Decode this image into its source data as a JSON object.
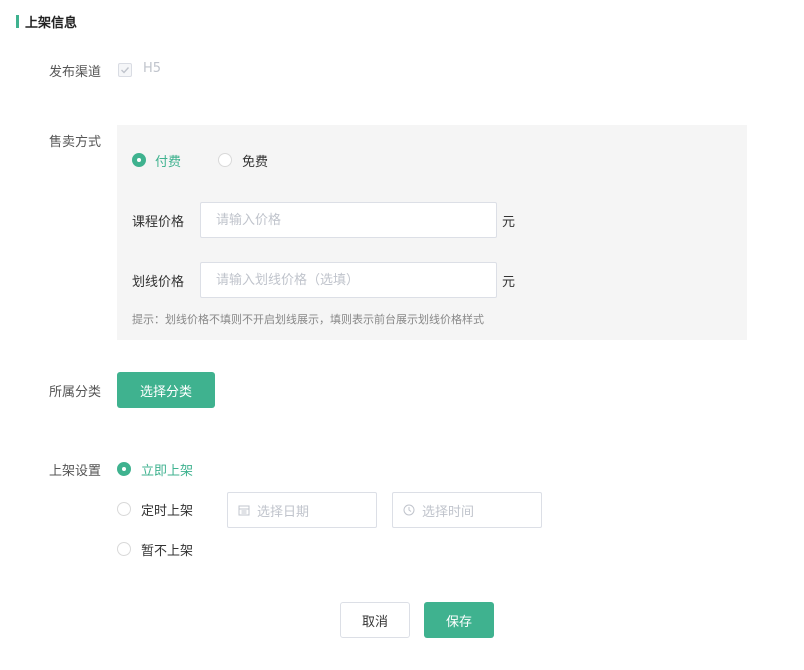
{
  "section": {
    "title": "上架信息"
  },
  "publish_channel": {
    "label": "发布渠道",
    "option": "H5",
    "checked": true,
    "disabled": true
  },
  "sale_method": {
    "label": "售卖方式",
    "options": [
      {
        "label": "付费",
        "selected": true
      },
      {
        "label": "免费",
        "selected": false
      }
    ],
    "course_price": {
      "label": "课程价格",
      "placeholder": "请输入价格",
      "unit": "元"
    },
    "strike_price": {
      "label": "划线价格",
      "placeholder": "请输入划线价格（选填）",
      "unit": "元"
    },
    "hint": "提示：划线价格不填则不开启划线展示，填则表示前台展示划线价格样式"
  },
  "category": {
    "label": "所属分类",
    "button": "选择分类"
  },
  "listing": {
    "label": "上架设置",
    "options": [
      {
        "label": "立即上架",
        "selected": true
      },
      {
        "label": "定时上架",
        "selected": false
      },
      {
        "label": "暂不上架",
        "selected": false
      }
    ],
    "date_placeholder": "选择日期",
    "time_placeholder": "选择时间"
  },
  "footer": {
    "cancel": "取消",
    "save": "保存"
  },
  "colors": {
    "accent": "#3fb28f",
    "panel": "#f5f5f5",
    "border": "#dcdfe6",
    "placeholder": "#c0c4cc"
  },
  "icons": {
    "date": "calendar-icon",
    "time": "clock-icon",
    "check": "check-icon"
  }
}
